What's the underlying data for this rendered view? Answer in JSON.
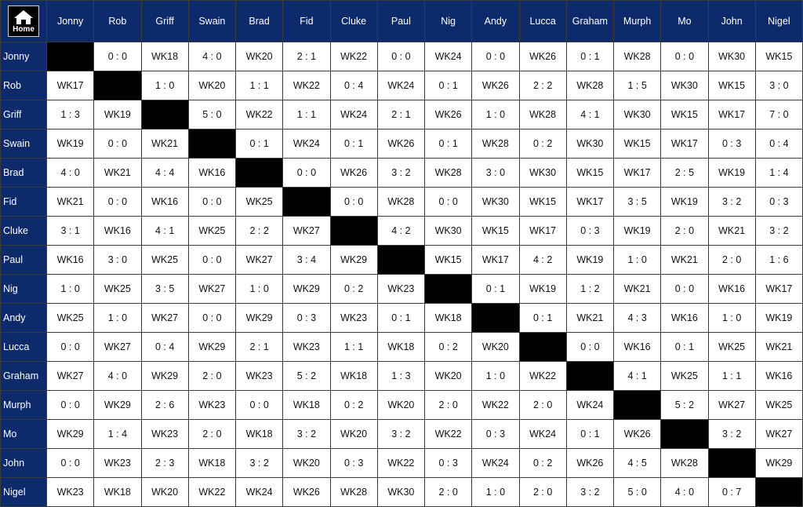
{
  "home_label": "Home",
  "colors": {
    "header_bg": "#0d2a6b",
    "header_text": "#ffffff",
    "self_cell": "#000000"
  },
  "players": [
    "Jonny",
    "Rob",
    "Griff",
    "Swain",
    "Brad",
    "Fid",
    "Cluke",
    "Paul",
    "Nig",
    "Andy",
    "Lucca",
    "Graham",
    "Murph",
    "Mo",
    "John",
    "Nigel"
  ],
  "matrix": [
    [
      "",
      "0 : 0",
      "WK18",
      "4 : 0",
      "WK20",
      "2 : 1",
      "WK22",
      "0 : 0",
      "WK24",
      "0 : 0",
      "WK26",
      "0 : 1",
      "WK28",
      "0 : 0",
      "WK30",
      "WK15"
    ],
    [
      "WK17",
      "",
      "1 : 0",
      "WK20",
      "1 : 1",
      "WK22",
      "0 : 4",
      "WK24",
      "0 : 1",
      "WK26",
      "2 : 2",
      "WK28",
      "1 : 5",
      "WK30",
      "WK15",
      "3 : 0"
    ],
    [
      "1 : 3",
      "WK19",
      "",
      "5 : 0",
      "WK22",
      "1 : 1",
      "WK24",
      "2 : 1",
      "WK26",
      "1 : 0",
      "WK28",
      "4 : 1",
      "WK30",
      "WK15",
      "WK17",
      "7 : 0"
    ],
    [
      "WK19",
      "0 : 0",
      "WK21",
      "",
      "0 : 1",
      "WK24",
      "0 : 1",
      "WK26",
      "0 : 1",
      "WK28",
      "0 : 2",
      "WK30",
      "WK15",
      "WK17",
      "0 : 3",
      "0 : 4"
    ],
    [
      "4 : 0",
      "WK21",
      "4 : 4",
      "WK16",
      "",
      "0 : 0",
      "WK26",
      "3 : 2",
      "WK28",
      "3 : 0",
      "WK30",
      "WK15",
      "WK17",
      "2 : 5",
      "WK19",
      "1 : 4"
    ],
    [
      "WK21",
      "0 : 0",
      "WK16",
      "0 : 0",
      "WK25",
      "",
      "0 : 0",
      "WK28",
      "0 : 0",
      "WK30",
      "WK15",
      "WK17",
      "3 : 5",
      "WK19",
      "3 : 2",
      "0 : 3"
    ],
    [
      "3 : 1",
      "WK16",
      "4 : 1",
      "WK25",
      "2 : 2",
      "WK27",
      "",
      "4 : 2",
      "WK30",
      "WK15",
      "WK17",
      "0 : 3",
      "WK19",
      "2 : 0",
      "WK21",
      "3 : 2"
    ],
    [
      "WK16",
      "3 : 0",
      "WK25",
      "0 : 0",
      "WK27",
      "3 : 4",
      "WK29",
      "",
      "WK15",
      "WK17",
      "4 : 2",
      "WK19",
      "1 : 0",
      "WK21",
      "2 : 0",
      "1 : 6"
    ],
    [
      "1 : 0",
      "WK25",
      "3 : 5",
      "WK27",
      "1 : 0",
      "WK29",
      "0 : 2",
      "WK23",
      "",
      "0 : 1",
      "WK19",
      "1 : 2",
      "WK21",
      "0 : 0",
      "WK16",
      "WK17"
    ],
    [
      "WK25",
      "1 : 0",
      "WK27",
      "0 : 0",
      "WK29",
      "0 : 3",
      "WK23",
      "0 : 1",
      "WK18",
      "",
      "0 : 1",
      "WK21",
      "4 : 3",
      "WK16",
      "1 : 0",
      "WK19"
    ],
    [
      "0 : 0",
      "WK27",
      "0 : 4",
      "WK29",
      "2 : 1",
      "WK23",
      "1 : 1",
      "WK18",
      "0 : 2",
      "WK20",
      "",
      "0 : 0",
      "WK16",
      "0 : 1",
      "WK25",
      "WK21"
    ],
    [
      "WK27",
      "4 : 0",
      "WK29",
      "2 : 0",
      "WK23",
      "5 : 2",
      "WK18",
      "1 : 3",
      "WK20",
      "1 : 0",
      "WK22",
      "",
      "4 : 1",
      "WK25",
      "1 : 1",
      "WK16"
    ],
    [
      "0 : 0",
      "WK29",
      "2 : 6",
      "WK23",
      "0 : 0",
      "WK18",
      "0 : 2",
      "WK20",
      "2 : 0",
      "WK22",
      "2 : 0",
      "WK24",
      "",
      "5 : 2",
      "WK27",
      "WK25"
    ],
    [
      "WK29",
      "1 : 4",
      "WK23",
      "2 : 0",
      "WK18",
      "3 : 2",
      "WK20",
      "3 : 2",
      "WK22",
      "0 : 3",
      "WK24",
      "0 : 1",
      "WK26",
      "",
      "3 : 2",
      "WK27"
    ],
    [
      "0 : 0",
      "WK23",
      "2 : 3",
      "WK18",
      "3 : 2",
      "WK20",
      "0 : 3",
      "WK22",
      "0 : 3",
      "WK24",
      "0 : 2",
      "WK26",
      "4 : 5",
      "WK28",
      "",
      "WK29"
    ],
    [
      "WK23",
      "WK18",
      "WK20",
      "WK22",
      "WK24",
      "WK26",
      "WK28",
      "WK30",
      "2 : 0",
      "1 : 0",
      "2 : 0",
      "3 : 2",
      "5 : 0",
      "4 : 0",
      "0 : 7",
      ""
    ]
  ]
}
